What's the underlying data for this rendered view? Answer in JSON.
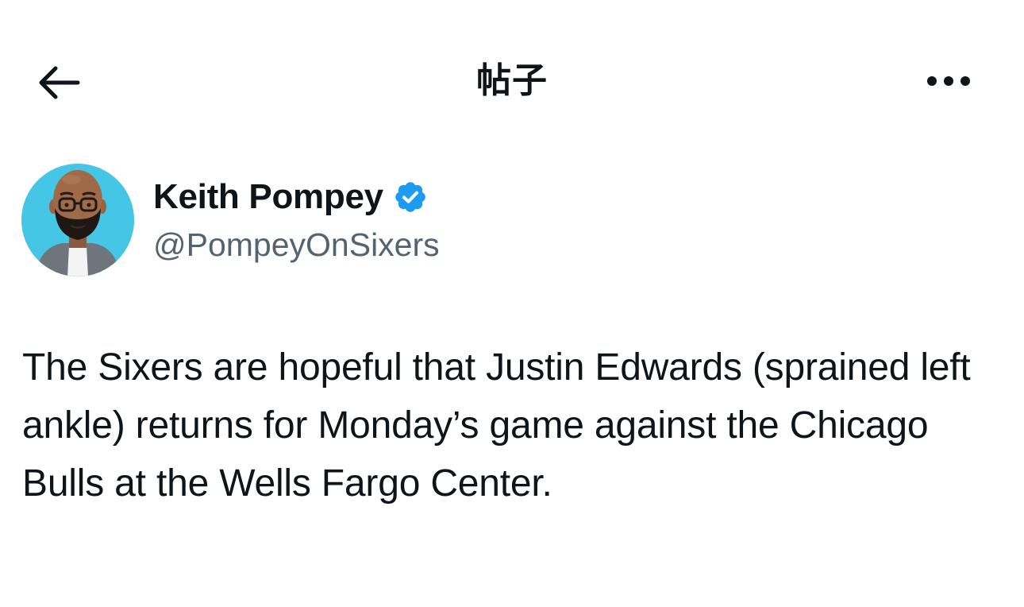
{
  "header": {
    "title": "帖子",
    "back_icon": "arrow-left-icon",
    "more_icon": "more-horizontal-icon"
  },
  "author": {
    "display_name": "Keith Pompey",
    "handle": "@PompeyOnSixers",
    "verified_icon": "verified-badge-icon",
    "verified_color": "#1d9bf0",
    "avatar": "memoji-avatar"
  },
  "post": {
    "text": "The Sixers are hopeful that Justin Edwards (sprained left ankle) returns for Monday’s game against the Chicago Bulls at the Wells Fargo Center."
  },
  "colors": {
    "text_primary": "#0f1419",
    "text_secondary": "#536471",
    "avatar_bg": "#45c6e6",
    "background": "#ffffff"
  }
}
